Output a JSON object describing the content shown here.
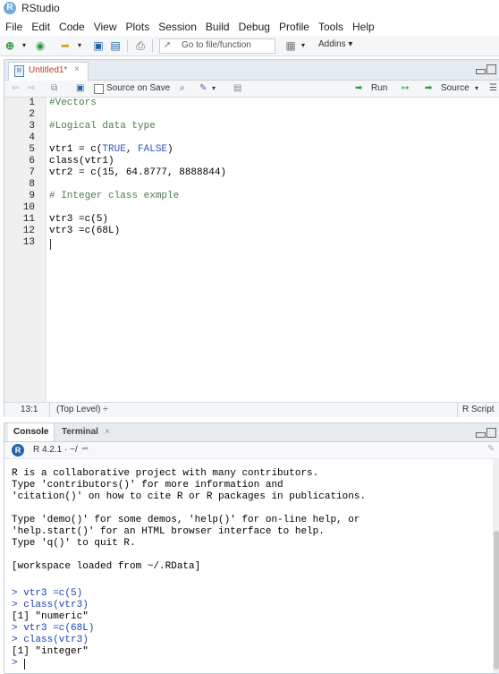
{
  "window": {
    "title": "RStudio"
  },
  "menu": [
    "File",
    "Edit",
    "Code",
    "View",
    "Plots",
    "Session",
    "Build",
    "Debug",
    "Profile",
    "Tools",
    "Help"
  ],
  "toolbar": {
    "goto_placeholder": "Go to file/function",
    "addins_label": "Addins ▾"
  },
  "editor": {
    "tab_label": "Untitled1*",
    "source_on_save_label": "Source on Save",
    "run_label": "Run",
    "source_label": "Source",
    "lines": [
      {
        "n": "1",
        "text": "#Vectors"
      },
      {
        "n": "2",
        "text": ""
      },
      {
        "n": "3",
        "text": "#Logical data type"
      },
      {
        "n": "4",
        "text": ""
      },
      {
        "n": "5",
        "text": "vtr1 = c(TRUE, FALSE)"
      },
      {
        "n": "6",
        "text": "class(vtr1)"
      },
      {
        "n": "7",
        "text": "vtr2 = c(15, 64.8777, 8888844)"
      },
      {
        "n": "8",
        "text": ""
      },
      {
        "n": "9",
        "text": "# Integer class exmple"
      },
      {
        "n": "10",
        "text": ""
      },
      {
        "n": "11",
        "text": "vtr3 =c(5)"
      },
      {
        "n": "12",
        "text": "vtr3 =c(68L)"
      },
      {
        "n": "13",
        "text": ""
      }
    ],
    "status_position": "13:1",
    "status_scope": "(Top Level) ÷",
    "status_type": "R Script"
  },
  "console": {
    "tab_console": "Console",
    "tab_terminal": "Terminal",
    "version": "R 4.2.1 · ~/",
    "lines": [
      "R is a collaborative project with many contributors.",
      "Type 'contributors()' for more information and",
      "'citation()' on how to cite R or R packages in publications.",
      "",
      "Type 'demo()' for some demos, 'help()' for on-line help, or",
      "'help.start()' for an HTML browser interface to help.",
      "Type 'q()' to quit R.",
      "",
      "[workspace loaded from ~/.RData]",
      "",
      "> vtr3 =c(5)",
      "> class(vtr3)",
      "[1] \"numeric\"",
      "> vtr3 =c(68L)",
      "> class(vtr3)",
      "[1] \"integer\"",
      "> "
    ]
  },
  "colors": {
    "accent": "#75aadb",
    "comment": "#4a7d4a",
    "keyword": "#3657b5",
    "prompt": "#1a3fb0",
    "tab_modified": "#c0392b"
  }
}
